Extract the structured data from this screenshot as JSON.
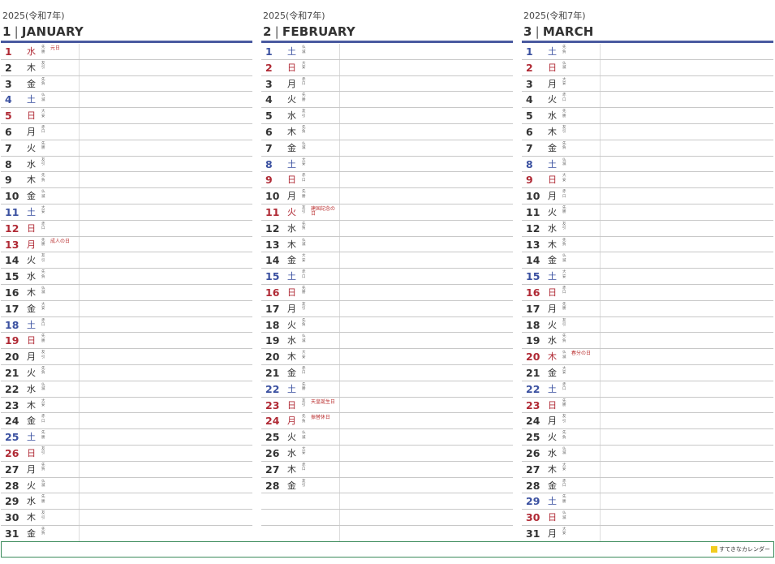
{
  "months": [
    {
      "year_label": "2025(令和7年)",
      "number": "1",
      "separator": "|",
      "name": "JANUARY",
      "days": [
        {
          "d": "1",
          "w": "水",
          "r": "先勝",
          "t": "hol",
          "h": "元日"
        },
        {
          "d": "2",
          "w": "木",
          "r": "友引",
          "t": "wd",
          "h": ""
        },
        {
          "d": "3",
          "w": "金",
          "r": "先負",
          "t": "wd",
          "h": ""
        },
        {
          "d": "4",
          "w": "土",
          "r": "仏滅",
          "t": "sat",
          "h": ""
        },
        {
          "d": "5",
          "w": "日",
          "r": "大安",
          "t": "sun",
          "h": ""
        },
        {
          "d": "6",
          "w": "月",
          "r": "赤口",
          "t": "wd",
          "h": ""
        },
        {
          "d": "7",
          "w": "火",
          "r": "先勝",
          "t": "wd",
          "h": ""
        },
        {
          "d": "8",
          "w": "水",
          "r": "友引",
          "t": "wd",
          "h": ""
        },
        {
          "d": "9",
          "w": "木",
          "r": "先負",
          "t": "wd",
          "h": ""
        },
        {
          "d": "10",
          "w": "金",
          "r": "仏滅",
          "t": "wd",
          "h": ""
        },
        {
          "d": "11",
          "w": "土",
          "r": "大安",
          "t": "sat",
          "h": ""
        },
        {
          "d": "12",
          "w": "日",
          "r": "赤口",
          "t": "sun",
          "h": ""
        },
        {
          "d": "13",
          "w": "月",
          "r": "先勝",
          "t": "hol",
          "h": "成人の日"
        },
        {
          "d": "14",
          "w": "火",
          "r": "友引",
          "t": "wd",
          "h": ""
        },
        {
          "d": "15",
          "w": "水",
          "r": "先負",
          "t": "wd",
          "h": ""
        },
        {
          "d": "16",
          "w": "木",
          "r": "仏滅",
          "t": "wd",
          "h": ""
        },
        {
          "d": "17",
          "w": "金",
          "r": "大安",
          "t": "wd",
          "h": ""
        },
        {
          "d": "18",
          "w": "土",
          "r": "赤口",
          "t": "sat",
          "h": ""
        },
        {
          "d": "19",
          "w": "日",
          "r": "先勝",
          "t": "sun",
          "h": ""
        },
        {
          "d": "20",
          "w": "月",
          "r": "友引",
          "t": "wd",
          "h": ""
        },
        {
          "d": "21",
          "w": "火",
          "r": "先負",
          "t": "wd",
          "h": ""
        },
        {
          "d": "22",
          "w": "水",
          "r": "仏滅",
          "t": "wd",
          "h": ""
        },
        {
          "d": "23",
          "w": "木",
          "r": "大安",
          "t": "wd",
          "h": ""
        },
        {
          "d": "24",
          "w": "金",
          "r": "赤口",
          "t": "wd",
          "h": ""
        },
        {
          "d": "25",
          "w": "土",
          "r": "先勝",
          "t": "sat",
          "h": ""
        },
        {
          "d": "26",
          "w": "日",
          "r": "友引",
          "t": "sun",
          "h": ""
        },
        {
          "d": "27",
          "w": "月",
          "r": "先負",
          "t": "wd",
          "h": ""
        },
        {
          "d": "28",
          "w": "火",
          "r": "仏滅",
          "t": "wd",
          "h": ""
        },
        {
          "d": "29",
          "w": "水",
          "r": "先勝",
          "t": "wd",
          "h": ""
        },
        {
          "d": "30",
          "w": "木",
          "r": "友引",
          "t": "wd",
          "h": ""
        },
        {
          "d": "31",
          "w": "金",
          "r": "先負",
          "t": "wd",
          "h": ""
        }
      ]
    },
    {
      "year_label": "2025(令和7年)",
      "number": "2",
      "separator": "|",
      "name": "FEBRUARY",
      "days": [
        {
          "d": "1",
          "w": "土",
          "r": "仏滅",
          "t": "sat",
          "h": ""
        },
        {
          "d": "2",
          "w": "日",
          "r": "大安",
          "t": "sun",
          "h": ""
        },
        {
          "d": "3",
          "w": "月",
          "r": "赤口",
          "t": "wd",
          "h": ""
        },
        {
          "d": "4",
          "w": "火",
          "r": "先勝",
          "t": "wd",
          "h": ""
        },
        {
          "d": "5",
          "w": "水",
          "r": "友引",
          "t": "wd",
          "h": ""
        },
        {
          "d": "6",
          "w": "木",
          "r": "先負",
          "t": "wd",
          "h": ""
        },
        {
          "d": "7",
          "w": "金",
          "r": "仏滅",
          "t": "wd",
          "h": ""
        },
        {
          "d": "8",
          "w": "土",
          "r": "大安",
          "t": "sat",
          "h": ""
        },
        {
          "d": "9",
          "w": "日",
          "r": "赤口",
          "t": "sun",
          "h": ""
        },
        {
          "d": "10",
          "w": "月",
          "r": "先勝",
          "t": "wd",
          "h": ""
        },
        {
          "d": "11",
          "w": "火",
          "r": "友引",
          "t": "hol",
          "h": "建国記念の日"
        },
        {
          "d": "12",
          "w": "水",
          "r": "先負",
          "t": "wd",
          "h": ""
        },
        {
          "d": "13",
          "w": "木",
          "r": "仏滅",
          "t": "wd",
          "h": ""
        },
        {
          "d": "14",
          "w": "金",
          "r": "大安",
          "t": "wd",
          "h": ""
        },
        {
          "d": "15",
          "w": "土",
          "r": "赤口",
          "t": "sat",
          "h": ""
        },
        {
          "d": "16",
          "w": "日",
          "r": "先勝",
          "t": "sun",
          "h": ""
        },
        {
          "d": "17",
          "w": "月",
          "r": "友引",
          "t": "wd",
          "h": ""
        },
        {
          "d": "18",
          "w": "火",
          "r": "先負",
          "t": "wd",
          "h": ""
        },
        {
          "d": "19",
          "w": "水",
          "r": "仏滅",
          "t": "wd",
          "h": ""
        },
        {
          "d": "20",
          "w": "木",
          "r": "大安",
          "t": "wd",
          "h": ""
        },
        {
          "d": "21",
          "w": "金",
          "r": "赤口",
          "t": "wd",
          "h": ""
        },
        {
          "d": "22",
          "w": "土",
          "r": "先勝",
          "t": "sat",
          "h": ""
        },
        {
          "d": "23",
          "w": "日",
          "r": "友引",
          "t": "sun",
          "h": "天皇誕生日"
        },
        {
          "d": "24",
          "w": "月",
          "r": "先負",
          "t": "hol",
          "h": "振替休日"
        },
        {
          "d": "25",
          "w": "火",
          "r": "仏滅",
          "t": "wd",
          "h": ""
        },
        {
          "d": "26",
          "w": "水",
          "r": "大安",
          "t": "wd",
          "h": ""
        },
        {
          "d": "27",
          "w": "木",
          "r": "赤口",
          "t": "wd",
          "h": ""
        },
        {
          "d": "28",
          "w": "金",
          "r": "友引",
          "t": "wd",
          "h": ""
        }
      ]
    },
    {
      "year_label": "2025(令和7年)",
      "number": "3",
      "separator": "|",
      "name": "MARCH",
      "days": [
        {
          "d": "1",
          "w": "土",
          "r": "先負",
          "t": "sat",
          "h": ""
        },
        {
          "d": "2",
          "w": "日",
          "r": "仏滅",
          "t": "sun",
          "h": ""
        },
        {
          "d": "3",
          "w": "月",
          "r": "大安",
          "t": "wd",
          "h": ""
        },
        {
          "d": "4",
          "w": "火",
          "r": "赤口",
          "t": "wd",
          "h": ""
        },
        {
          "d": "5",
          "w": "水",
          "r": "先勝",
          "t": "wd",
          "h": ""
        },
        {
          "d": "6",
          "w": "木",
          "r": "友引",
          "t": "wd",
          "h": ""
        },
        {
          "d": "7",
          "w": "金",
          "r": "先負",
          "t": "wd",
          "h": ""
        },
        {
          "d": "8",
          "w": "土",
          "r": "仏滅",
          "t": "sat",
          "h": ""
        },
        {
          "d": "9",
          "w": "日",
          "r": "大安",
          "t": "sun",
          "h": ""
        },
        {
          "d": "10",
          "w": "月",
          "r": "赤口",
          "t": "wd",
          "h": ""
        },
        {
          "d": "11",
          "w": "火",
          "r": "先勝",
          "t": "wd",
          "h": ""
        },
        {
          "d": "12",
          "w": "水",
          "r": "友引",
          "t": "wd",
          "h": ""
        },
        {
          "d": "13",
          "w": "木",
          "r": "先負",
          "t": "wd",
          "h": ""
        },
        {
          "d": "14",
          "w": "金",
          "r": "仏滅",
          "t": "wd",
          "h": ""
        },
        {
          "d": "15",
          "w": "土",
          "r": "大安",
          "t": "sat",
          "h": ""
        },
        {
          "d": "16",
          "w": "日",
          "r": "赤口",
          "t": "sun",
          "h": ""
        },
        {
          "d": "17",
          "w": "月",
          "r": "先勝",
          "t": "wd",
          "h": ""
        },
        {
          "d": "18",
          "w": "火",
          "r": "友引",
          "t": "wd",
          "h": ""
        },
        {
          "d": "19",
          "w": "水",
          "r": "先負",
          "t": "wd",
          "h": ""
        },
        {
          "d": "20",
          "w": "木",
          "r": "仏滅",
          "t": "hol",
          "h": "春分の日"
        },
        {
          "d": "21",
          "w": "金",
          "r": "大安",
          "t": "wd",
          "h": ""
        },
        {
          "d": "22",
          "w": "土",
          "r": "赤口",
          "t": "sat",
          "h": ""
        },
        {
          "d": "23",
          "w": "日",
          "r": "先勝",
          "t": "sun",
          "h": ""
        },
        {
          "d": "24",
          "w": "月",
          "r": "友引",
          "t": "wd",
          "h": ""
        },
        {
          "d": "25",
          "w": "火",
          "r": "先負",
          "t": "wd",
          "h": ""
        },
        {
          "d": "26",
          "w": "水",
          "r": "仏滅",
          "t": "wd",
          "h": ""
        },
        {
          "d": "27",
          "w": "木",
          "r": "大安",
          "t": "wd",
          "h": ""
        },
        {
          "d": "28",
          "w": "金",
          "r": "赤口",
          "t": "wd",
          "h": ""
        },
        {
          "d": "29",
          "w": "土",
          "r": "先勝",
          "t": "sat",
          "h": ""
        },
        {
          "d": "30",
          "w": "日",
          "r": "仏滅",
          "t": "sun",
          "h": ""
        },
        {
          "d": "31",
          "w": "月",
          "r": "大安",
          "t": "wd",
          "h": ""
        }
      ]
    }
  ],
  "footer": {
    "brand_text": "すてきなカレンダー",
    "brand_icon": "yellow-square-icon"
  },
  "colors": {
    "header_rule": "#4a5aa0",
    "saturday": "#3a50a0",
    "sunday_holiday": "#b02a35",
    "footer_border": "#3a8a5a",
    "brand_square": "#f2cc20"
  }
}
